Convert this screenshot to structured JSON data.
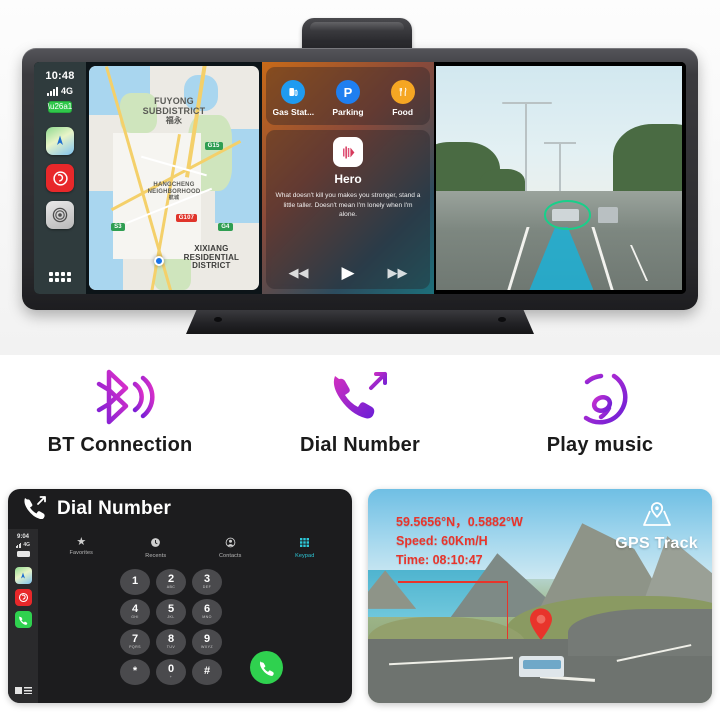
{
  "hero": {
    "device_name": "car-display-unit",
    "carplay": {
      "status": {
        "time": "10:48",
        "network": "4G",
        "battery_icon": "battery-charging-icon"
      },
      "apps": [
        {
          "name": "maps-app-icon",
          "glyph": "➤"
        },
        {
          "name": "netease-music-app-icon",
          "glyph": "♫"
        },
        {
          "name": "system-settings-app-icon",
          "glyph": "◎"
        }
      ],
      "launcher": "app-grid-icon"
    },
    "map": {
      "labels": [
        {
          "text": "FUYONG",
          "sub": "SUBDISTRICT",
          "cjk": "福永"
        },
        {
          "text": "HANGCHENG",
          "sub": "NEIGHBORHOOD",
          "cjk": "航城"
        },
        {
          "text": "XIXIANG",
          "sub": "RESIDENTIAL",
          "sub2": "DISTRICT"
        }
      ],
      "shields": [
        "G15",
        "S3",
        "G107",
        "G4"
      ]
    },
    "widgets": {
      "poi": [
        {
          "label": "Gas Stat...",
          "icon": "fuel-pump-icon",
          "color": "#1f9bf0",
          "glyph": "⛽"
        },
        {
          "label": "Parking",
          "icon": "parking-icon",
          "color": "#1f7ff0",
          "glyph": "P"
        },
        {
          "label": "Food",
          "icon": "restaurant-icon",
          "color": "#f5a623",
          "glyph": "🍴"
        }
      ],
      "music": {
        "album_icon": "album-art-waveform-icon",
        "title": "Hero",
        "lyrics": "What doesn't kill you makes you stronger, stand a little taller. Doesn't mean I'm lonely when I'm alone.",
        "prev": "◀◀",
        "play": "▶",
        "next": "▶▶"
      }
    },
    "dashcam": {
      "name": "dashcam-live-view",
      "lane_highlight_color": "#17b4dc",
      "detect_color": "#18d08a"
    }
  },
  "features": [
    {
      "label": "BT  Connection",
      "icon": "bluetooth-icon"
    },
    {
      "label": "Dial Number",
      "icon": "phone-outgoing-icon"
    },
    {
      "label": "Play music",
      "icon": "music-disc-icon"
    }
  ],
  "dial_card": {
    "title": "Dial Number",
    "title_icon": "phone-outgoing-icon",
    "status": {
      "time": "9:04",
      "network": "4G"
    },
    "apps": [
      {
        "name": "maps-app-icon",
        "glyph": "➤"
      },
      {
        "name": "netease-music-app-icon",
        "glyph": "♫"
      },
      {
        "name": "phone-app-icon",
        "glyph": "✆"
      }
    ],
    "tabs": [
      {
        "label": "Favorites",
        "icon": "star-icon",
        "glyph": "★",
        "active": false
      },
      {
        "label": "Recents",
        "icon": "clock-icon",
        "glyph": "🕓",
        "active": false
      },
      {
        "label": "Contacts",
        "icon": "person-icon",
        "glyph": "◉",
        "active": false
      },
      {
        "label": "Keypad",
        "icon": "keypad-grid-icon",
        "glyph": "∷",
        "active": true
      }
    ],
    "keys": [
      {
        "d": "1",
        "s": ""
      },
      {
        "d": "2",
        "s": "ABC"
      },
      {
        "d": "3",
        "s": "DEF"
      },
      {
        "d": "4",
        "s": "GHI"
      },
      {
        "d": "5",
        "s": "JKL"
      },
      {
        "d": "6",
        "s": "MNO"
      },
      {
        "d": "7",
        "s": "PQRS"
      },
      {
        "d": "8",
        "s": "TUV"
      },
      {
        "d": "9",
        "s": "WXYZ"
      },
      {
        "d": "*",
        "s": ""
      },
      {
        "d": "0",
        "s": "+"
      },
      {
        "d": "#",
        "s": ""
      }
    ],
    "call_button": {
      "name": "call-button",
      "glyph": "✆",
      "color": "#2fd14f"
    }
  },
  "gps_card": {
    "badge_label": "GPS Track",
    "badge_icon": "map-pin-icon",
    "coordinates": "59.5656°N，0.5882°W",
    "speed": "Speed: 60Km/H",
    "time": "Time: 08:10:47",
    "pin_icon": "location-pin-icon",
    "accent_color": "#e8342b"
  }
}
